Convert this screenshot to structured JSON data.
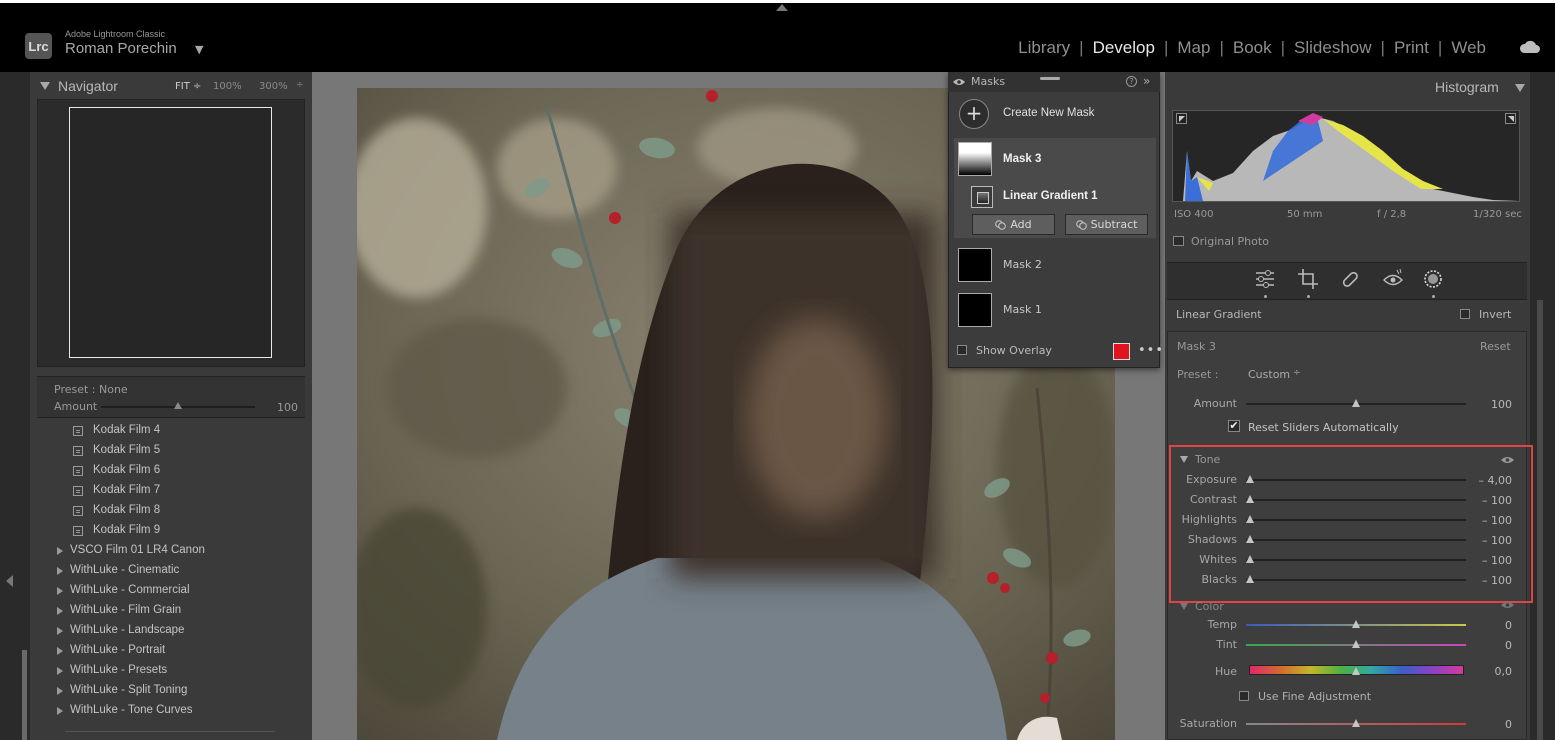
{
  "app": {
    "name": "Adobe Lightroom Classic",
    "logo_text": "Lrc",
    "user": "Roman Porechin",
    "user_caret": "▼"
  },
  "modules": {
    "items": [
      "Library",
      "Develop",
      "Map",
      "Book",
      "Slideshow",
      "Print",
      "Web"
    ],
    "active": "Develop",
    "separator": "|"
  },
  "navigator": {
    "title": "Navigator",
    "zoom_fit": "FIT ÷",
    "zoom_100": "100%",
    "zoom_300": "300%",
    "zoom_caret": "÷"
  },
  "preset_bar": {
    "preset_label": "Preset :",
    "preset_value": "None",
    "amount_label": "Amount",
    "amount_value": "100",
    "amount_fraction": 0.5
  },
  "preset_list": {
    "presets": [
      "Kodak Film 4",
      "Kodak Film 5",
      "Kodak Film 6",
      "Kodak Film 7",
      "Kodak Film 8",
      "Kodak Film 9"
    ],
    "groups": [
      "VSCO Film 01 LR4 Canon",
      "WithLuke - Cinematic",
      "WithLuke - Commercial",
      "WithLuke - Film Grain",
      "WithLuke - Landscape",
      "WithLuke - Portrait",
      "WithLuke - Presets",
      "WithLuke - Split Toning",
      "WithLuke - Tone Curves"
    ]
  },
  "masks_panel": {
    "title": "Masks",
    "help": "?",
    "collapse": "»",
    "create_label": "Create New Mask",
    "create_icon": "+",
    "mask3": "Mask 3",
    "linear_gradient": "Linear Gradient 1",
    "add": "Add",
    "subtract": "Subtract",
    "mask2": "Mask 2",
    "mask1": "Mask 1",
    "show_overlay": "Show Overlay",
    "overlay_color": "#e0131e",
    "more": "•••"
  },
  "histogram": {
    "title": "Histogram",
    "iso": "ISO 400",
    "focal": "50 mm",
    "aperture": "f / 2,8",
    "shutter": "1/320 sec",
    "original_photo": "Original Photo"
  },
  "tools": [
    "edit-sliders-icon",
    "crop-icon",
    "healing-icon",
    "red-eye-icon",
    "masking-icon"
  ],
  "mask_settings": {
    "section_label": "Linear Gradient",
    "invert_label": "Invert",
    "mask_title": "Mask 3",
    "reset": "Reset",
    "preset_label": "Preset :",
    "preset_value": "Custom",
    "preset_caret": "÷",
    "amount_label": "Amount",
    "amount_value": "100",
    "amount_fraction": 0.5,
    "reset_sliders_label": "Reset Sliders Automatically",
    "reset_sliders_checked": "✔"
  },
  "tone": {
    "label": "Tone",
    "sliders": [
      {
        "label": "Exposure",
        "value": "– 4,00",
        "fraction": 0.0
      },
      {
        "label": "Contrast",
        "value": "– 100",
        "fraction": 0.0
      },
      {
        "label": "Highlights",
        "value": "– 100",
        "fraction": 0.0
      },
      {
        "label": "Shadows",
        "value": "– 100",
        "fraction": 0.0
      },
      {
        "label": "Whites",
        "value": "– 100",
        "fraction": 0.0
      },
      {
        "label": "Blacks",
        "value": "– 100",
        "fraction": 0.0
      }
    ]
  },
  "color": {
    "label": "Color",
    "temp_label": "Temp",
    "temp_value": "0",
    "tint_label": "Tint",
    "tint_value": "0",
    "hue_label": "Hue",
    "hue_value": "0,0",
    "use_fine": "Use Fine Adjustment",
    "saturation_label": "Saturation",
    "saturation_value": "0"
  },
  "colors": {
    "highlight_box": "#e04545",
    "active_module": "#e8e8e8"
  }
}
